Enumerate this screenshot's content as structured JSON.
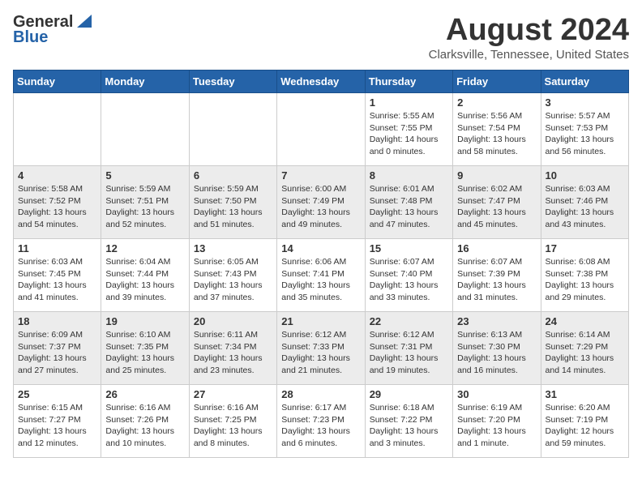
{
  "header": {
    "logo_general": "General",
    "logo_blue": "Blue",
    "month_year": "August 2024",
    "location": "Clarksville, Tennessee, United States"
  },
  "days_of_week": [
    "Sunday",
    "Monday",
    "Tuesday",
    "Wednesday",
    "Thursday",
    "Friday",
    "Saturday"
  ],
  "weeks": [
    {
      "days": [
        {
          "num": "",
          "info": ""
        },
        {
          "num": "",
          "info": ""
        },
        {
          "num": "",
          "info": ""
        },
        {
          "num": "",
          "info": ""
        },
        {
          "num": "1",
          "info": "Sunrise: 5:55 AM\nSunset: 7:55 PM\nDaylight: 14 hours\nand 0 minutes."
        },
        {
          "num": "2",
          "info": "Sunrise: 5:56 AM\nSunset: 7:54 PM\nDaylight: 13 hours\nand 58 minutes."
        },
        {
          "num": "3",
          "info": "Sunrise: 5:57 AM\nSunset: 7:53 PM\nDaylight: 13 hours\nand 56 minutes."
        }
      ]
    },
    {
      "days": [
        {
          "num": "4",
          "info": "Sunrise: 5:58 AM\nSunset: 7:52 PM\nDaylight: 13 hours\nand 54 minutes."
        },
        {
          "num": "5",
          "info": "Sunrise: 5:59 AM\nSunset: 7:51 PM\nDaylight: 13 hours\nand 52 minutes."
        },
        {
          "num": "6",
          "info": "Sunrise: 5:59 AM\nSunset: 7:50 PM\nDaylight: 13 hours\nand 51 minutes."
        },
        {
          "num": "7",
          "info": "Sunrise: 6:00 AM\nSunset: 7:49 PM\nDaylight: 13 hours\nand 49 minutes."
        },
        {
          "num": "8",
          "info": "Sunrise: 6:01 AM\nSunset: 7:48 PM\nDaylight: 13 hours\nand 47 minutes."
        },
        {
          "num": "9",
          "info": "Sunrise: 6:02 AM\nSunset: 7:47 PM\nDaylight: 13 hours\nand 45 minutes."
        },
        {
          "num": "10",
          "info": "Sunrise: 6:03 AM\nSunset: 7:46 PM\nDaylight: 13 hours\nand 43 minutes."
        }
      ]
    },
    {
      "days": [
        {
          "num": "11",
          "info": "Sunrise: 6:03 AM\nSunset: 7:45 PM\nDaylight: 13 hours\nand 41 minutes."
        },
        {
          "num": "12",
          "info": "Sunrise: 6:04 AM\nSunset: 7:44 PM\nDaylight: 13 hours\nand 39 minutes."
        },
        {
          "num": "13",
          "info": "Sunrise: 6:05 AM\nSunset: 7:43 PM\nDaylight: 13 hours\nand 37 minutes."
        },
        {
          "num": "14",
          "info": "Sunrise: 6:06 AM\nSunset: 7:41 PM\nDaylight: 13 hours\nand 35 minutes."
        },
        {
          "num": "15",
          "info": "Sunrise: 6:07 AM\nSunset: 7:40 PM\nDaylight: 13 hours\nand 33 minutes."
        },
        {
          "num": "16",
          "info": "Sunrise: 6:07 AM\nSunset: 7:39 PM\nDaylight: 13 hours\nand 31 minutes."
        },
        {
          "num": "17",
          "info": "Sunrise: 6:08 AM\nSunset: 7:38 PM\nDaylight: 13 hours\nand 29 minutes."
        }
      ]
    },
    {
      "days": [
        {
          "num": "18",
          "info": "Sunrise: 6:09 AM\nSunset: 7:37 PM\nDaylight: 13 hours\nand 27 minutes."
        },
        {
          "num": "19",
          "info": "Sunrise: 6:10 AM\nSunset: 7:35 PM\nDaylight: 13 hours\nand 25 minutes."
        },
        {
          "num": "20",
          "info": "Sunrise: 6:11 AM\nSunset: 7:34 PM\nDaylight: 13 hours\nand 23 minutes."
        },
        {
          "num": "21",
          "info": "Sunrise: 6:12 AM\nSunset: 7:33 PM\nDaylight: 13 hours\nand 21 minutes."
        },
        {
          "num": "22",
          "info": "Sunrise: 6:12 AM\nSunset: 7:31 PM\nDaylight: 13 hours\nand 19 minutes."
        },
        {
          "num": "23",
          "info": "Sunrise: 6:13 AM\nSunset: 7:30 PM\nDaylight: 13 hours\nand 16 minutes."
        },
        {
          "num": "24",
          "info": "Sunrise: 6:14 AM\nSunset: 7:29 PM\nDaylight: 13 hours\nand 14 minutes."
        }
      ]
    },
    {
      "days": [
        {
          "num": "25",
          "info": "Sunrise: 6:15 AM\nSunset: 7:27 PM\nDaylight: 13 hours\nand 12 minutes."
        },
        {
          "num": "26",
          "info": "Sunrise: 6:16 AM\nSunset: 7:26 PM\nDaylight: 13 hours\nand 10 minutes."
        },
        {
          "num": "27",
          "info": "Sunrise: 6:16 AM\nSunset: 7:25 PM\nDaylight: 13 hours\nand 8 minutes."
        },
        {
          "num": "28",
          "info": "Sunrise: 6:17 AM\nSunset: 7:23 PM\nDaylight: 13 hours\nand 6 minutes."
        },
        {
          "num": "29",
          "info": "Sunrise: 6:18 AM\nSunset: 7:22 PM\nDaylight: 13 hours\nand 3 minutes."
        },
        {
          "num": "30",
          "info": "Sunrise: 6:19 AM\nSunset: 7:20 PM\nDaylight: 13 hours\nand 1 minute."
        },
        {
          "num": "31",
          "info": "Sunrise: 6:20 AM\nSunset: 7:19 PM\nDaylight: 12 hours\nand 59 minutes."
        }
      ]
    }
  ]
}
